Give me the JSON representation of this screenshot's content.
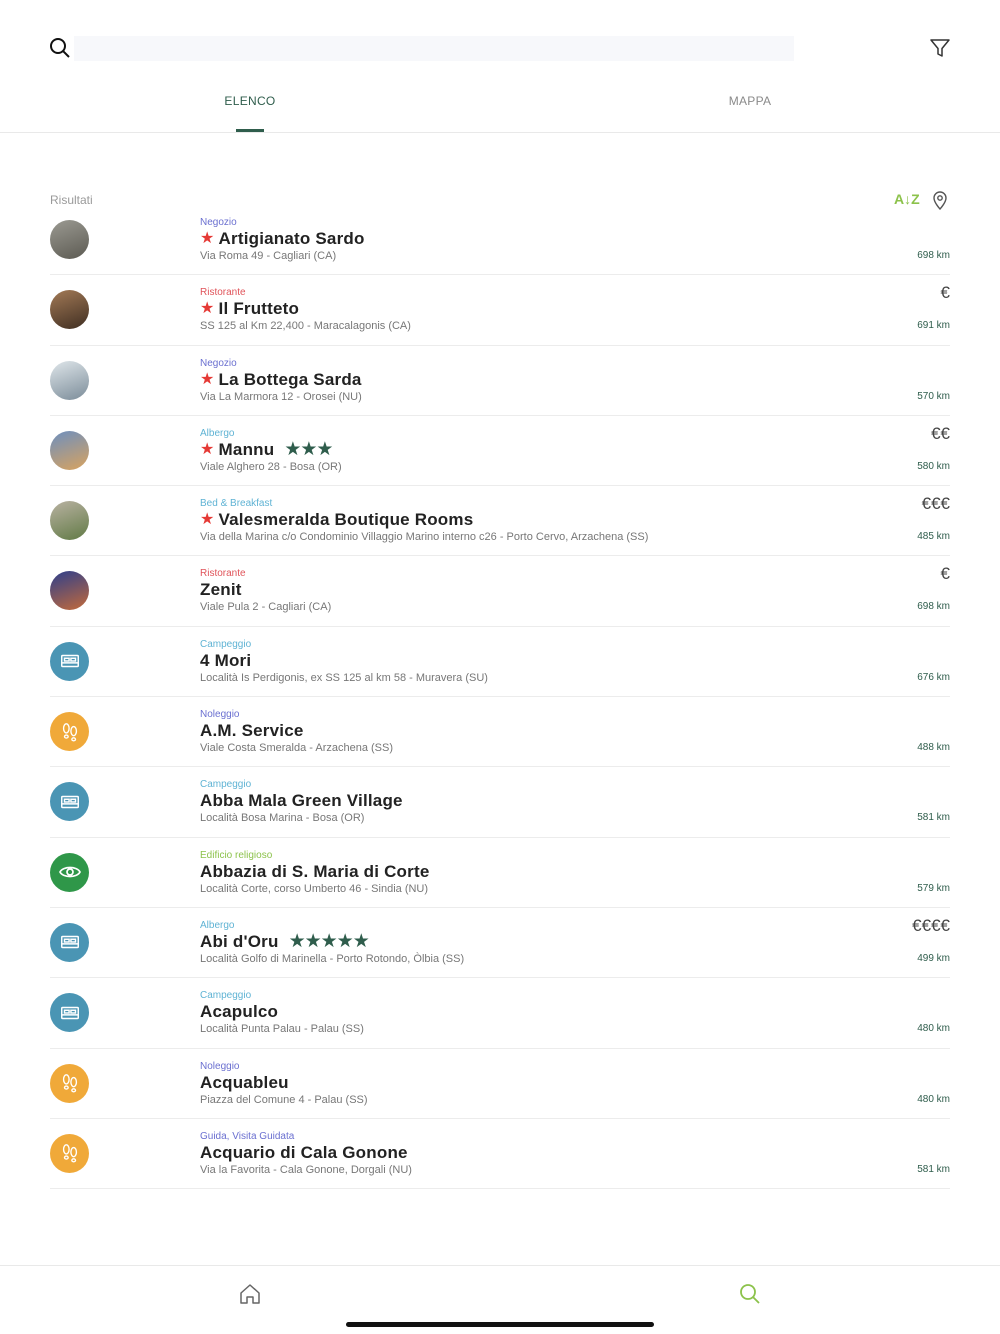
{
  "search": {
    "placeholder": "",
    "value": ""
  },
  "tabs": [
    {
      "label": "ELENCO",
      "active": true
    },
    {
      "label": "MAPPA",
      "active": false
    }
  ],
  "list_header": {
    "results_label": "Risultati",
    "sort_label": "A↓Z"
  },
  "colors": {
    "accent_green": "#2f5d4c",
    "sort_green": "#8cc24b",
    "star_red": "#e53935",
    "cat_negozio": "#6a6fd0",
    "cat_ristorante": "#e0545a",
    "cat_albergo": "#5fb3d4",
    "cat_bnb": "#5fb3d4",
    "cat_campeggio": "#5fb3d4",
    "cat_noleggio": "#6a6fd0",
    "cat_edificio": "#8cc24b",
    "cat_guida": "#6a6fd0",
    "icon_blue": "#4a95b4",
    "icon_orange": "#f0a939",
    "icon_green": "#2f9749"
  },
  "items": [
    {
      "category": "Negozio",
      "cat_color": "#6a6fd0",
      "name": "Artigianato Sardo",
      "featured": true,
      "stars": "",
      "address": "Via Roma 49 - Cagliari (CA)",
      "price": "",
      "distance": "698 km",
      "avatar": "photo",
      "photo_colors": [
        "#9b9a92",
        "#5c5a52"
      ]
    },
    {
      "category": "Ristorante",
      "cat_color": "#e0545a",
      "name": "Il Frutteto",
      "featured": true,
      "stars": "",
      "address": "SS 125 al Km 22,400 - Maracalagonis (CA)",
      "price": "€",
      "distance": "691 km",
      "avatar": "photo",
      "photo_colors": [
        "#a37a56",
        "#3f2e22"
      ]
    },
    {
      "category": "Negozio",
      "cat_color": "#6a6fd0",
      "name": "La Bottega Sarda",
      "featured": true,
      "stars": "",
      "address": "Via La Marmora 12 - Orosei (NU)",
      "price": "",
      "distance": "570 km",
      "avatar": "photo",
      "photo_colors": [
        "#dfe6ea",
        "#7b8c99"
      ]
    },
    {
      "category": "Albergo",
      "cat_color": "#5fb3d4",
      "name": "Mannu",
      "featured": true,
      "stars": "★★★",
      "address": "Viale Alghero 28 - Bosa (OR)",
      "price": "€€",
      "distance": "580 km",
      "avatar": "photo",
      "photo_colors": [
        "#6d8fbf",
        "#d9a35e"
      ]
    },
    {
      "category": "Bed & Breakfast",
      "cat_color": "#5fb3d4",
      "name": "Valesmeralda Boutique Rooms",
      "featured": true,
      "stars": "",
      "address": "Via della Marina c/o Condominio Villaggio Marino interno c26 - Porto Cervo, Arzachena (SS)",
      "price": "€€€",
      "distance": "485 km",
      "avatar": "photo",
      "photo_colors": [
        "#b9b2a2",
        "#617a45"
      ]
    },
    {
      "category": "Ristorante",
      "cat_color": "#e0545a",
      "name": "Zenit",
      "featured": false,
      "stars": "",
      "address": "Viale Pula 2 - Cagliari (CA)",
      "price": "€",
      "distance": "698 km",
      "avatar": "photo",
      "photo_colors": [
        "#2d3f8c",
        "#c46a3a"
      ]
    },
    {
      "category": "Campeggio",
      "cat_color": "#5fb3d4",
      "name": "4 Mori",
      "featured": false,
      "stars": "",
      "address": "Località Is Perdigonis, ex SS 125 al km 58 - Muravera (SU)",
      "price": "",
      "distance": "676 km",
      "avatar": "bed"
    },
    {
      "category": "Noleggio",
      "cat_color": "#6a6fd0",
      "name": "A.M. Service",
      "featured": false,
      "stars": "",
      "address": "Viale Costa Smeralda - Arzachena (SS)",
      "price": "",
      "distance": "488 km",
      "avatar": "feet"
    },
    {
      "category": "Campeggio",
      "cat_color": "#5fb3d4",
      "name": "Abba Mala Green Village",
      "featured": false,
      "stars": "",
      "address": "Località Bosa Marina - Bosa (OR)",
      "price": "",
      "distance": "581 km",
      "avatar": "bed"
    },
    {
      "category": "Edificio religioso",
      "cat_color": "#8cc24b",
      "name": "Abbazia di S. Maria di Corte",
      "featured": false,
      "stars": "",
      "address": "Località Corte, corso Umberto 46 - Sindia (NU)",
      "price": "",
      "distance": "579 km",
      "avatar": "eye"
    },
    {
      "category": "Albergo",
      "cat_color": "#5fb3d4",
      "name": "Abi d'Oru",
      "featured": false,
      "stars": "★★★★★",
      "address": "Località Golfo di Marinella - Porto Rotondo, Òlbia (SS)",
      "price": "€€€€",
      "distance": "499 km",
      "avatar": "bed"
    },
    {
      "category": "Campeggio",
      "cat_color": "#5fb3d4",
      "name": "Acapulco",
      "featured": false,
      "stars": "",
      "address": "Località Punta Palau - Palau (SS)",
      "price": "",
      "distance": "480 km",
      "avatar": "bed"
    },
    {
      "category": "Noleggio",
      "cat_color": "#6a6fd0",
      "name": "Acquableu",
      "featured": false,
      "stars": "",
      "address": "Piazza del Comune 4 - Palau (SS)",
      "price": "",
      "distance": "480 km",
      "avatar": "feet"
    },
    {
      "category": "Guida, Visita Guidata",
      "cat_color": "#6a6fd0",
      "name": "Acquario di Cala Gonone",
      "featured": false,
      "stars": "",
      "address": "Via la Favorita - Cala Gonone, Dorgali (NU)",
      "price": "",
      "distance": "581 km",
      "avatar": "feet"
    }
  ],
  "bottom_nav": [
    {
      "icon": "home-icon",
      "active": false
    },
    {
      "icon": "search-icon",
      "active": true
    }
  ]
}
